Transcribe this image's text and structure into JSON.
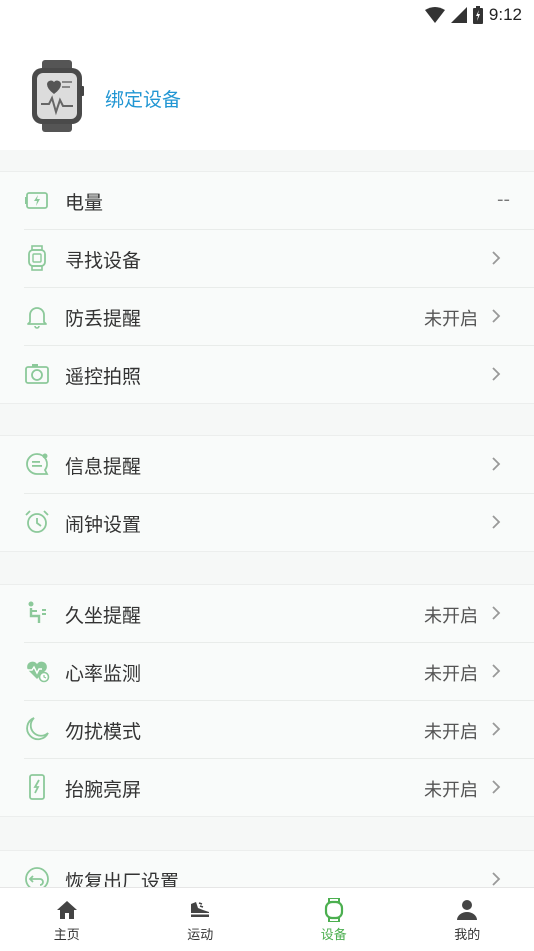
{
  "status_bar": {
    "time": "9:12"
  },
  "header": {
    "bind_label": "绑定设备",
    "accent": "#2196d3"
  },
  "groups": [
    {
      "rows": [
        {
          "icon": "battery-icon",
          "label": "电量",
          "value": "--"
        },
        {
          "icon": "find-device-icon",
          "label": "寻找设备",
          "value": ""
        },
        {
          "icon": "bell-icon",
          "label": "防丢提醒",
          "value": "未开启"
        },
        {
          "icon": "camera-icon",
          "label": "遥控拍照",
          "value": ""
        }
      ]
    },
    {
      "rows": [
        {
          "icon": "message-icon",
          "label": "信息提醒",
          "value": ""
        },
        {
          "icon": "alarm-icon",
          "label": "闹钟设置",
          "value": ""
        }
      ]
    },
    {
      "rows": [
        {
          "icon": "sedentary-icon",
          "label": "久坐提醒",
          "value": "未开启"
        },
        {
          "icon": "heart-rate-icon",
          "label": "心率监测",
          "value": "未开启"
        },
        {
          "icon": "moon-icon",
          "label": "勿扰模式",
          "value": "未开启"
        },
        {
          "icon": "wrist-raise-icon",
          "label": "抬腕亮屏",
          "value": "未开启"
        }
      ]
    },
    {
      "rows": [
        {
          "icon": "reset-icon",
          "label": "恢复出厂设置",
          "value": ""
        }
      ]
    }
  ],
  "bottom_nav": [
    {
      "icon": "home-icon",
      "label": "主页",
      "active": false
    },
    {
      "icon": "sport-icon",
      "label": "运动",
      "active": false
    },
    {
      "icon": "watch-icon",
      "label": "设备",
      "active": true
    },
    {
      "icon": "user-icon",
      "label": "我的",
      "active": false
    }
  ],
  "colors": {
    "icon_green": "#8cc99a",
    "active_green": "#4caf50"
  }
}
